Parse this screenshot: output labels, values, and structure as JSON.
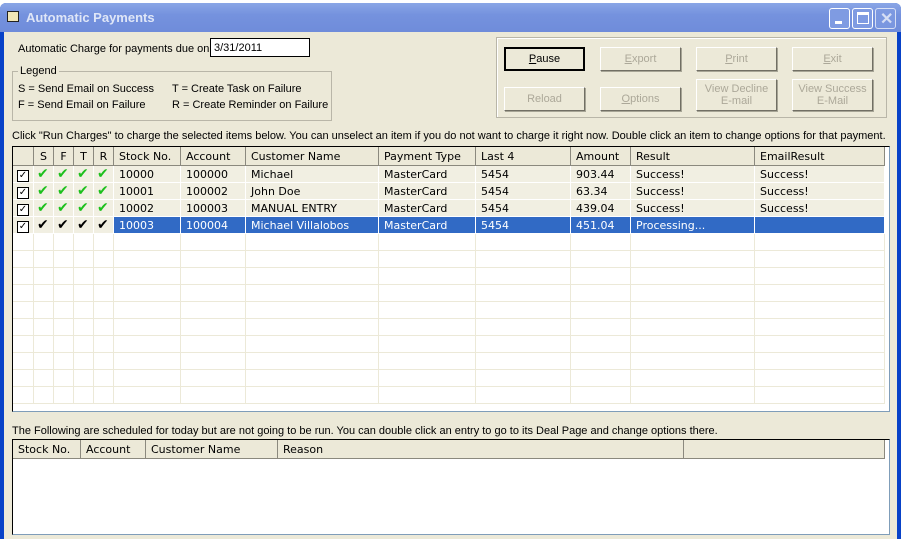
{
  "window": {
    "title": "Automatic Payments",
    "icon": "folder-icon",
    "controls": [
      "minimize",
      "maximize",
      "close"
    ]
  },
  "due_date": {
    "label": "Automatic Charge for payments due on:",
    "value": "3/31/2011"
  },
  "legend": {
    "title": "Legend",
    "items": [
      "S = Send Email on Success",
      "F = Send Email on Failure",
      "T = Create Task on Failure",
      "R = Create Reminder on Failure"
    ]
  },
  "buttons": [
    {
      "label": "Pause",
      "accel": "P",
      "rest": "ause",
      "enabled": true
    },
    {
      "label": "Export",
      "accel": "E",
      "rest": "xport",
      "enabled": false
    },
    {
      "label": "Print",
      "accel": "P",
      "rest": "rint",
      "enabled": false
    },
    {
      "label": "Exit",
      "accel": "E",
      "rest": "xit",
      "enabled": false
    },
    {
      "label": "Reload",
      "enabled": false
    },
    {
      "label": "Options",
      "accel": "O",
      "rest": "ptions",
      "enabled": false
    },
    {
      "label": "View Decline",
      "label2": "E-mail",
      "enabled": false
    },
    {
      "label": "View Success",
      "label2": "E-Mail",
      "enabled": false
    }
  ],
  "instructions": "Click \"Run Charges\" to charge the selected items below. You can unselect an item if you do not want to charge it right now. Double click an item to change options for that payment.",
  "charges_table": {
    "columns": [
      "",
      "S",
      "F",
      "T",
      "R",
      "Stock No.",
      "Account",
      "Customer Name",
      "Payment Type",
      "Last 4",
      "Amount",
      "Result",
      "EmailResult"
    ],
    "rows": [
      {
        "checked": true,
        "flags": [
          true,
          true,
          true,
          true
        ],
        "stock": "10000",
        "account": "100000",
        "customer": "Michael",
        "payment_type": "MasterCard",
        "last4": "5454",
        "amount": "903.44",
        "result": "Success!",
        "email_result": "Success!"
      },
      {
        "checked": true,
        "flags": [
          true,
          true,
          true,
          true
        ],
        "stock": "10001",
        "account": "100002",
        "customer": "John Doe",
        "payment_type": "MasterCard",
        "last4": "5454",
        "amount": "63.34",
        "result": "Success!",
        "email_result": "Success!"
      },
      {
        "checked": true,
        "flags": [
          true,
          true,
          true,
          true
        ],
        "stock": "10002",
        "account": "100003",
        "customer": "MANUAL ENTRY",
        "payment_type": "MasterCard",
        "last4": "5454",
        "amount": "439.04",
        "result": "Success!",
        "email_result": "Success!"
      },
      {
        "checked": true,
        "flags": [
          true,
          true,
          true,
          true
        ],
        "stock": "10003",
        "account": "100004",
        "customer": "Michael Villalobos",
        "payment_type": "MasterCard",
        "last4": "5454",
        "amount": "451.04",
        "result": "Processing...",
        "email_result": "",
        "selected": true
      }
    ]
  },
  "skipped_note": "The Following are scheduled for today but are not going to be run. You can double click an entry to go to its Deal Page and change options there.",
  "skipped_table": {
    "columns": [
      "Stock No.",
      "Account",
      "Customer Name",
      "Reason"
    ],
    "rows": []
  },
  "colors": {
    "selection": "#316ac5",
    "check": "#1dc01d",
    "face": "#ece9d8",
    "title": "#7592de"
  }
}
